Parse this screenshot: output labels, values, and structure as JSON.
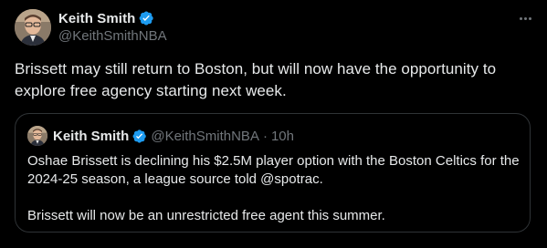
{
  "theme": {
    "background": "#000000",
    "text_primary": "#e7e9ea",
    "text_secondary": "#71767b",
    "verified_color": "#1d9bf0",
    "border": "#2f3336"
  },
  "tweet": {
    "author": {
      "display_name": "Keith Smith",
      "handle": "@KeithSmithNBA",
      "verified": true,
      "avatar_icon": "profile-photo"
    },
    "more_icon": "more-horizontal-icon",
    "text": "Brissett may still return to Boston, but will now have the opportunity to explore free agency starting next week."
  },
  "quoted_tweet": {
    "author": {
      "display_name": "Keith Smith",
      "handle": "@KeithSmithNBA",
      "verified": true
    },
    "separator": "·",
    "time": "10h",
    "paragraphs": [
      "Oshae Brissett is declining his $2.5M player option with the Boston Celtics for the 2024-25 season, a league source told @spotrac.",
      "Brissett will now be an unrestricted free agent this summer."
    ]
  }
}
